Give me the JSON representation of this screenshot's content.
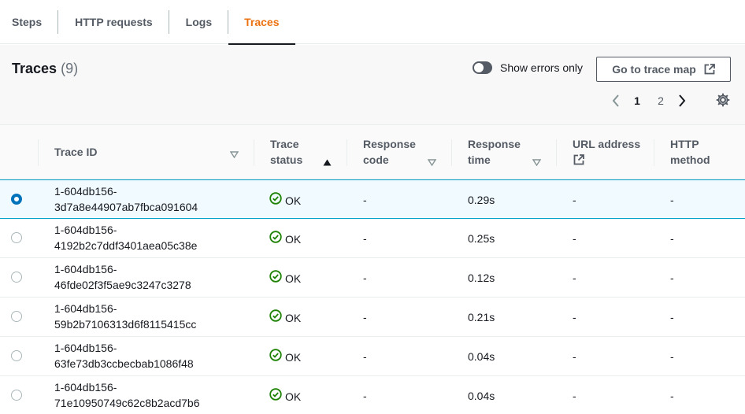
{
  "tabs": [
    {
      "label": "Steps"
    },
    {
      "label": "HTTP requests"
    },
    {
      "label": "Logs"
    },
    {
      "label": "Traces",
      "active": true
    }
  ],
  "header": {
    "title": "Traces",
    "count": "(9)",
    "toggle_label": "Show errors only",
    "map_button": "Go to trace map"
  },
  "pagination": {
    "pages": [
      "1",
      "2"
    ],
    "current": "1"
  },
  "columns": {
    "trace_id": "Trace ID",
    "status_line1": "Trace",
    "status_line2": "status",
    "code_line1": "Response",
    "code_line2": "code",
    "time_line1": "Response",
    "time_line2": "time",
    "url_line1": "URL address",
    "method_line1": "HTTP",
    "method_line2": "method"
  },
  "rows": [
    {
      "id1": "1-604db156-",
      "id2": "3d7a8e44907ab7fbca091604",
      "status": "OK",
      "code": "-",
      "time": "0.29s",
      "url": "-",
      "method": "-",
      "selected": true
    },
    {
      "id1": "1-604db156-",
      "id2": "4192b2c7ddf3401aea05c38e",
      "status": "OK",
      "code": "-",
      "time": "0.25s",
      "url": "-",
      "method": "-"
    },
    {
      "id1": "1-604db156-",
      "id2": "46fde02f3f5ae9c3247c3278",
      "status": "OK",
      "code": "-",
      "time": "0.12s",
      "url": "-",
      "method": "-"
    },
    {
      "id1": "1-604db156-",
      "id2": "59b2b7106313d6f8115415cc",
      "status": "OK",
      "code": "-",
      "time": "0.21s",
      "url": "-",
      "method": "-"
    },
    {
      "id1": "1-604db156-",
      "id2": "63fe73db3ccbecbab1086f48",
      "status": "OK",
      "code": "-",
      "time": "0.04s",
      "url": "-",
      "method": "-"
    },
    {
      "id1": "1-604db156-",
      "id2": "71e10950749c62c8b2acd7b6",
      "status": "OK",
      "code": "-",
      "time": "0.04s",
      "url": "-",
      "method": "-"
    }
  ],
  "colors": {
    "accent": "#ec7211",
    "selected_radio": "#0073bb",
    "ok_green": "#1d8102",
    "selected_row_bg": "#f1faff"
  },
  "icons": {
    "toggle": "toggle-off-icon",
    "external": "external-link-icon",
    "prev": "chevron-left-icon",
    "next": "chevron-right-icon",
    "settings": "gear-icon",
    "sort": "caret-down-icon",
    "sorted": "caret-up-icon",
    "status_ok": "check-circle-icon"
  }
}
